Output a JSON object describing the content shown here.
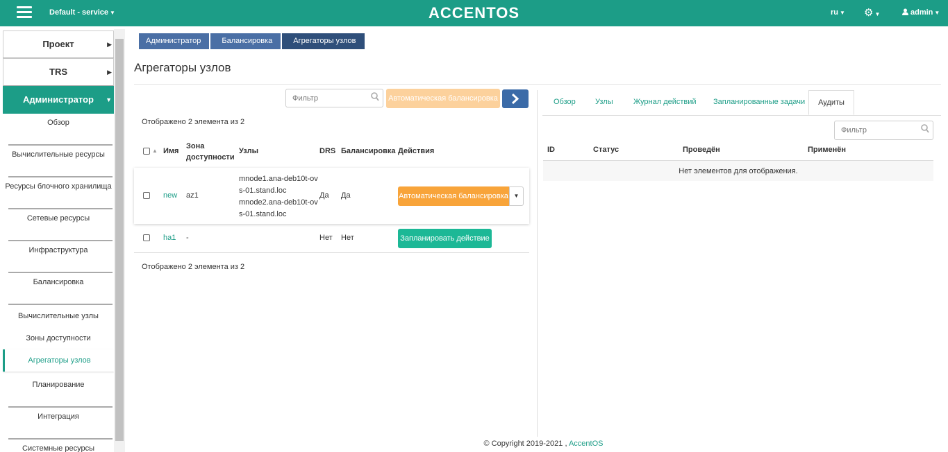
{
  "topbar": {
    "project": "Default - service",
    "logo": "ACCENTOS",
    "lang": "ru",
    "user": "admin"
  },
  "sidebar": {
    "main": [
      {
        "label": "Проект"
      },
      {
        "label": "TRS"
      },
      {
        "label": "Администратор"
      }
    ],
    "sub": [
      {
        "label": "Обзор"
      },
      {
        "label": "Вычислительные ресурсы"
      },
      {
        "label": "Ресурсы блочного хранилища"
      },
      {
        "label": "Сетевые ресурсы"
      },
      {
        "label": "Инфраструктура"
      },
      {
        "label": "Балансировка"
      }
    ],
    "balancing_items": [
      {
        "label": "Вычислительные узлы"
      },
      {
        "label": "Зоны доступности"
      },
      {
        "label": "Агрегаторы узлов"
      }
    ],
    "after": [
      {
        "label": "Планирование"
      },
      {
        "label": "Интеграция"
      },
      {
        "label": "Системные ресурсы"
      }
    ]
  },
  "breadcrumb": [
    "Администратор",
    "Балансировка",
    "Агрегаторы узлов"
  ],
  "page_title": "Агрегаторы узлов",
  "left": {
    "filter_placeholder": "Фильтр",
    "auto_balance_label": "Автоматическая балансировка",
    "count_text": "Отображено 2 элемента из 2",
    "columns": {
      "name": "Имя",
      "zone": "Зона доступности",
      "nodes": "Узлы",
      "drs": "DRS",
      "balancing": "Балансировка",
      "actions": "Действия"
    },
    "rows": [
      {
        "name": "new",
        "zone": "az1",
        "nodes": [
          "mnode1.ana-deb10t-ov",
          "s-01.stand.loc",
          "mnode2.ana-deb10t-ov",
          "s-01.stand.loc"
        ],
        "drs": "Да",
        "balancing": "Да",
        "action": "Автоматическая балансировка"
      },
      {
        "name": "ha1",
        "zone": "-",
        "drs": "Нет",
        "balancing": "Нет",
        "action": "Запланировать действие"
      }
    ]
  },
  "right": {
    "tabs": [
      "Обзор",
      "Узлы",
      "Журнал действий",
      "Запланированные задачи",
      "Аудиты"
    ],
    "filter_placeholder": "Фильтр",
    "columns": {
      "id": "ID",
      "status": "Статус",
      "done": "Проведён",
      "applied": "Применён"
    },
    "empty": "Нет элементов для отображения."
  },
  "footer": {
    "copyright": "© Copyright 2019-2021 ,",
    "brand": "AccentOS"
  },
  "colors": {
    "accent": "#1c9d87",
    "orange": "#f8a43a",
    "green": "#1cb896",
    "breadcrumb": "#4a6fa5"
  }
}
